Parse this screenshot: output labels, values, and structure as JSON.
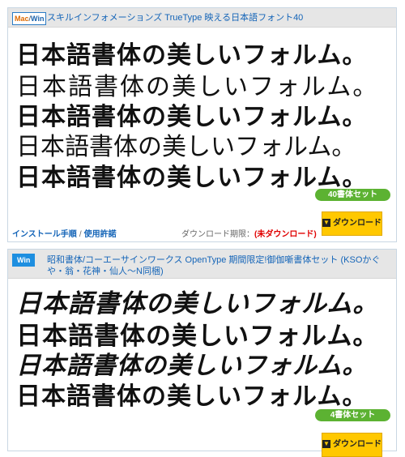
{
  "fonts": [
    {
      "os_badge": {
        "mac": "Mac",
        "sep": "/",
        "win": "Win"
      },
      "title": "スキルインフォメーションズ  TrueType  映える日本語フォント40",
      "preview_lines": [
        "日本語書体の美しいフォルム。",
        "日本語書体の美しいフォルム。",
        "日本語書体の美しいフォルム。",
        "日本語書体の美しいフォルム。",
        "日本語書体の美しいフォルム。"
      ],
      "set_label": "40書体セット",
      "links": {
        "install": "インストール手順",
        "sep": "/",
        "license": "使用許諾"
      },
      "download_period_label": "ダウンロード期限：",
      "download_period_value": "(未ダウンロード)",
      "download_button": "ダウンロード"
    },
    {
      "os_badge": {
        "win": "Win"
      },
      "title": "昭和書体/コーエーサインワークス  OpenType  期間限定!御伽噺書体セット (KSOかぐや・翁・花神・仙人〜N同梱)",
      "preview_lines": [
        "日本語書体の美しいフォルム。",
        "日本語書体の美しいフォルム。",
        "日本語書体の美しいフォルム。",
        "日本語書体の美しいフォルム。"
      ],
      "set_label": "4書体セット",
      "download_button": "ダウンロード"
    }
  ]
}
